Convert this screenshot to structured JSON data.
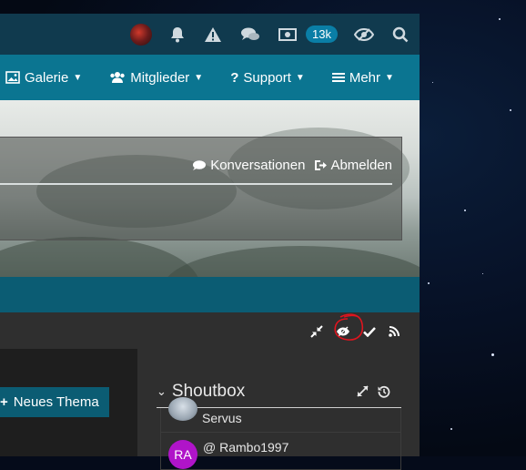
{
  "topbar": {
    "notification_count": "13k"
  },
  "nav": {
    "items": [
      {
        "label": "Galerie"
      },
      {
        "label": "Mitglieder"
      },
      {
        "label": "Support"
      },
      {
        "label": "Mehr"
      }
    ]
  },
  "user_panel": {
    "conversations_label": "Konversationen",
    "logout_label": "Abmelden"
  },
  "actions": {
    "new_thread_label": "Neues Thema"
  },
  "shoutbox": {
    "title": "Shoutbox",
    "messages": [
      {
        "text": "Servus"
      },
      {
        "author_initials": "RA",
        "text": "@ Rambo1997"
      }
    ]
  },
  "colors": {
    "topbar": "#103a4e",
    "navbar": "#0b7591",
    "accent": "#0b5c73",
    "annotation": "#e0141e"
  }
}
